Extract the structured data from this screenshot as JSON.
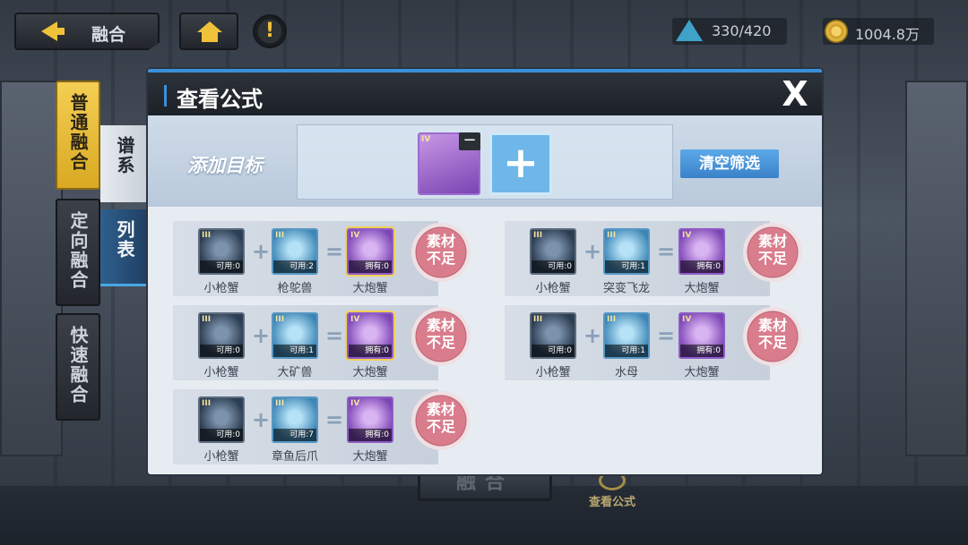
{
  "topbar": {
    "back_label": "融合",
    "alert_label": "!",
    "energy": "330/420",
    "gold": "1004.8万"
  },
  "side_tabs": [
    {
      "label": "普通融合",
      "active": true
    },
    {
      "label": "定向融合",
      "active": false
    },
    {
      "label": "快速融合",
      "active": false
    }
  ],
  "sub_tabs": [
    {
      "label": "谱系",
      "active": false
    },
    {
      "label": "列表",
      "active": true
    }
  ],
  "background": {
    "fuse_button": "融合",
    "formula_label": "查看公式"
  },
  "modal": {
    "title": "查看公式",
    "close": "X",
    "add_target_label": "添加目标",
    "target_card_rank": "IV",
    "remove_symbol": "−",
    "add_symbol": "+",
    "clear_filter": "清空筛选",
    "plus": "+",
    "equals": "=",
    "lack_label_line1": "素材",
    "lack_label_line2": "不足",
    "formulas": [
      {
        "a": {
          "rank": "III",
          "count": "可用:0",
          "name": "小枪蟹"
        },
        "b": {
          "rank": "III",
          "count": "可用:2",
          "name": "枪鸵兽"
        },
        "result": {
          "rank": "IV",
          "count": "拥有:0",
          "name": "大炮蟹"
        }
      },
      {
        "a": {
          "rank": "III",
          "count": "可用:0",
          "name": "小枪蟹"
        },
        "b": {
          "rank": "III",
          "count": "可用:1",
          "name": "突变飞龙"
        },
        "result": {
          "rank": "IV",
          "count": "拥有:0",
          "name": "大炮蟹"
        }
      },
      {
        "a": {
          "rank": "III",
          "count": "可用:0",
          "name": "小枪蟹"
        },
        "b": {
          "rank": "III",
          "count": "可用:1",
          "name": "大矿兽"
        },
        "result": {
          "rank": "IV",
          "count": "拥有:0",
          "name": "大炮蟹"
        }
      },
      {
        "a": {
          "rank": "III",
          "count": "可用:0",
          "name": "小枪蟹"
        },
        "b": {
          "rank": "III",
          "count": "可用:1",
          "name": "水母"
        },
        "result": {
          "rank": "IV",
          "count": "拥有:0",
          "name": "大炮蟹"
        }
      },
      {
        "a": {
          "rank": "III",
          "count": "可用:0",
          "name": "小枪蟹"
        },
        "b": {
          "rank": "III",
          "count": "可用:7",
          "name": "章鱼后爪"
        },
        "result": {
          "rank": "IV",
          "count": "拥有:0",
          "name": "大炮蟹"
        }
      }
    ]
  }
}
